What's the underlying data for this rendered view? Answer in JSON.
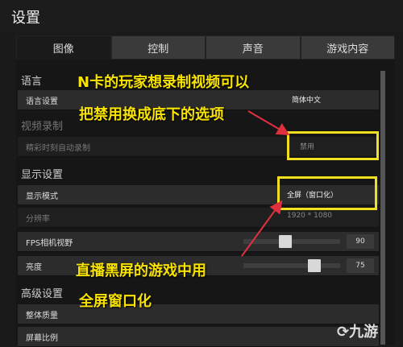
{
  "title": "设置",
  "tabs": [
    "图像",
    "控制",
    "声音",
    "游戏内容"
  ],
  "sections": {
    "language": "语言",
    "video_record": "视频录制",
    "display": "显示设置",
    "advanced": "高级设置"
  },
  "rows": {
    "language_setting": {
      "label": "语言设置",
      "value": "简体中文"
    },
    "highlight_record": {
      "label": "精彩时刻自动录制",
      "value": "禁用"
    },
    "display_mode": {
      "label": "显示模式",
      "value": "全屏（窗口化）"
    },
    "resolution": {
      "label": "分辨率",
      "value": "1920 * 1080"
    },
    "fps_fov": {
      "label": "FPS相机视野",
      "value": "90"
    },
    "brightness": {
      "label": "亮度",
      "value": "75"
    },
    "overall_quality": {
      "label": "整体质量"
    },
    "screen_ratio": {
      "label": "屏幕比例"
    }
  },
  "annotations": {
    "line1": "N卡的玩家想录制视频可以",
    "line2": "把禁用换成底下的选项",
    "line3": "直播黑屏的游戏中用",
    "line4": "全屏窗口化"
  },
  "logo": "九游",
  "colors": {
    "highlight": "#f0e020",
    "annotation": "#f8e200",
    "arrow": "#e03040"
  }
}
